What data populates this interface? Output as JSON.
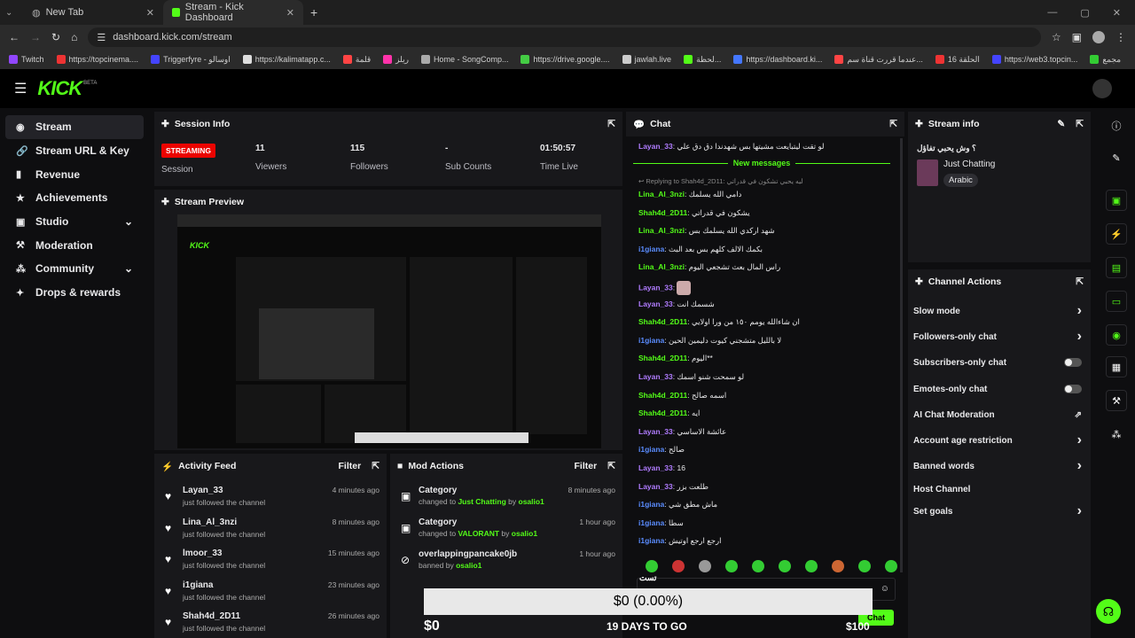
{
  "browser": {
    "tabs": [
      {
        "label": "New Tab"
      },
      {
        "label": "Stream - Kick Dashboard"
      }
    ],
    "url": "dashboard.kick.com/stream",
    "bookmarks": [
      "Twitch",
      "https://topcinema....",
      "Triggerfyre - اوسالو",
      "https://kalimatapp.c...",
      "قلمة",
      "ريلز",
      "Home - SongComp...",
      "https://drive.google....",
      "jawlah.live",
      "لحظة...",
      "https://dashboard.ki...",
      "عندما قررت قناة سم...",
      "الحلقة 16",
      "https://web3.topcin...",
      "مجمع"
    ]
  },
  "brand": {
    "logo": "KICK",
    "beta": "BETA"
  },
  "sidebar": {
    "items": [
      {
        "label": "Stream",
        "icon": "broadcast-icon"
      },
      {
        "label": "Stream URL & Key",
        "icon": "link-icon"
      },
      {
        "label": "Revenue",
        "icon": "revenue-icon"
      },
      {
        "label": "Achievements",
        "icon": "trophy-icon"
      },
      {
        "label": "Studio",
        "icon": "studio-icon"
      },
      {
        "label": "Moderation",
        "icon": "wrench-icon"
      },
      {
        "label": "Community",
        "icon": "people-icon"
      },
      {
        "label": "Drops & rewards",
        "icon": "gift-icon"
      }
    ]
  },
  "session": {
    "title": "Session Info",
    "status": "STREAMING",
    "status_label": "Session",
    "stats": [
      {
        "value": "11",
        "label": "Viewers"
      },
      {
        "value": "115",
        "label": "Followers"
      },
      {
        "value": "-",
        "label": "Sub Counts"
      },
      {
        "value": "01:50:57",
        "label": "Time Live"
      }
    ]
  },
  "preview": {
    "title": "Stream Preview"
  },
  "activity": {
    "title": "Activity Feed",
    "filter": "Filter",
    "rows": [
      {
        "name": "Layan_33",
        "sub": "just followed the channel",
        "time": "4 minutes ago"
      },
      {
        "name": "Lina_Al_3nzi",
        "sub": "just followed the channel",
        "time": "8 minutes ago"
      },
      {
        "name": "lmoor_33",
        "sub": "just followed the channel",
        "time": "15 minutes ago"
      },
      {
        "name": "i1giana",
        "sub": "just followed the channel",
        "time": "23 minutes ago"
      },
      {
        "name": "Shah4d_2D11",
        "sub": "just followed the channel",
        "time": "26 minutes ago"
      }
    ]
  },
  "mod": {
    "title": "Mod Actions",
    "filter": "Filter",
    "rows": [
      {
        "name": "Category",
        "pre": "changed to",
        "target": "Just Chatting",
        "by": "by",
        "who": "osalio1",
        "time": "8 minutes ago"
      },
      {
        "name": "Category",
        "pre": "changed to",
        "target": "VALORANT",
        "by": "by",
        "who": "osalio1",
        "time": "1 hour ago"
      },
      {
        "name": "overlappingpancake0jb",
        "pre": "banned by",
        "target": "",
        "by": "",
        "who": "osalio1",
        "time": "1 hour ago"
      }
    ]
  },
  "chat": {
    "title": "Chat",
    "new_messages": "New messages",
    "reply": "Replying to Shah4d_2D11: ليه يحبي تشكون في قدراتي",
    "lines": [
      {
        "user": "Layan_33",
        "color": "#b07cff",
        "text": "لو تقت ليتبايعت مشيتها بس شهدندا دق دق علي"
      },
      {
        "user": "Lina_Al_3nzi",
        "color": "#53fc18",
        "text": "دامي الله يسلمك"
      },
      {
        "user": "Shah4d_2D11",
        "color": "#53fc18",
        "text": "يشكون في قدراتي"
      },
      {
        "user": "Lina_Al_3nzi",
        "color": "#53fc18",
        "text": "شهد اركدي الله يسلمك بس"
      },
      {
        "user": "i1giana",
        "color": "#5a8cff",
        "text": "بكمك الالف كلهم بس بعد البث"
      },
      {
        "user": "Lina_Al_3nzi",
        "color": "#53fc18",
        "text": "راس المال بعث تشجعي اليوم"
      },
      {
        "user": "Layan_33",
        "color": "#b07cff",
        "text": ""
      },
      {
        "user": "Layan_33",
        "color": "#b07cff",
        "text": "شسمك انت"
      },
      {
        "user": "Shah4d_2D11",
        "color": "#53fc18",
        "text": "ان شاءالله يومم ١٥٠ من ورا اولايي"
      },
      {
        "user": "i1giana",
        "color": "#5a8cff",
        "text": "لا بالليل متشجني كيوت دليمين الحين"
      },
      {
        "user": "Shah4d_2D11",
        "color": "#53fc18",
        "text": "اليوم**"
      },
      {
        "user": "Layan_33",
        "color": "#b07cff",
        "text": "لو سمحت شنو اسمك"
      },
      {
        "user": "Shah4d_2D11",
        "color": "#53fc18",
        "text": "اسمه صالح"
      },
      {
        "user": "Shah4d_2D11",
        "color": "#53fc18",
        "text": "ايه"
      },
      {
        "user": "Layan_33",
        "color": "#b07cff",
        "text": "عائشة الاساسي"
      },
      {
        "user": "i1giana",
        "color": "#5a8cff",
        "text": "صالح"
      },
      {
        "user": "Layan_33",
        "color": "#b07cff",
        "text": "16"
      },
      {
        "user": "Layan_33",
        "color": "#b07cff",
        "text": "طلعت بزر"
      },
      {
        "user": "i1giana",
        "color": "#5a8cff",
        "text": "ماش مطق شي"
      },
      {
        "user": "i1giana",
        "color": "#5a8cff",
        "text": "سطا"
      },
      {
        "user": "i1giana",
        "color": "#5a8cff",
        "text": "ارجع ارجع اوتيش"
      }
    ],
    "input_text": "تست",
    "chat_button": "Chat"
  },
  "streaminfo": {
    "title": "Stream info",
    "stream_title": "؟ وش يحبي تفاؤل",
    "category": "Just Chatting",
    "language": "Arabic"
  },
  "channel_actions": {
    "title": "Channel Actions",
    "rows": [
      {
        "label": "Slow mode",
        "ctl": "arrow"
      },
      {
        "label": "Followers-only chat",
        "ctl": "arrow"
      },
      {
        "label": "Subscribers-only chat",
        "ctl": "toggle"
      },
      {
        "label": "Emotes-only chat",
        "ctl": "toggle"
      },
      {
        "label": "AI Chat Moderation",
        "ctl": "external"
      },
      {
        "label": "Account age restriction",
        "ctl": "arrow"
      },
      {
        "label": "Banned words",
        "ctl": "arrow"
      },
      {
        "label": "Host Channel",
        "ctl": "none"
      },
      {
        "label": "Set goals",
        "ctl": "arrow"
      }
    ]
  },
  "goal": {
    "amount_pct": "$0 (0.00%)",
    "current": "$0",
    "days": "19 DAYS TO GO",
    "target": "$100",
    "progress": 0.0
  },
  "colors": {
    "accent": "#53fc18",
    "streaming": "#eb0400",
    "bg": "#0e0e10",
    "panel": "#18181b"
  }
}
